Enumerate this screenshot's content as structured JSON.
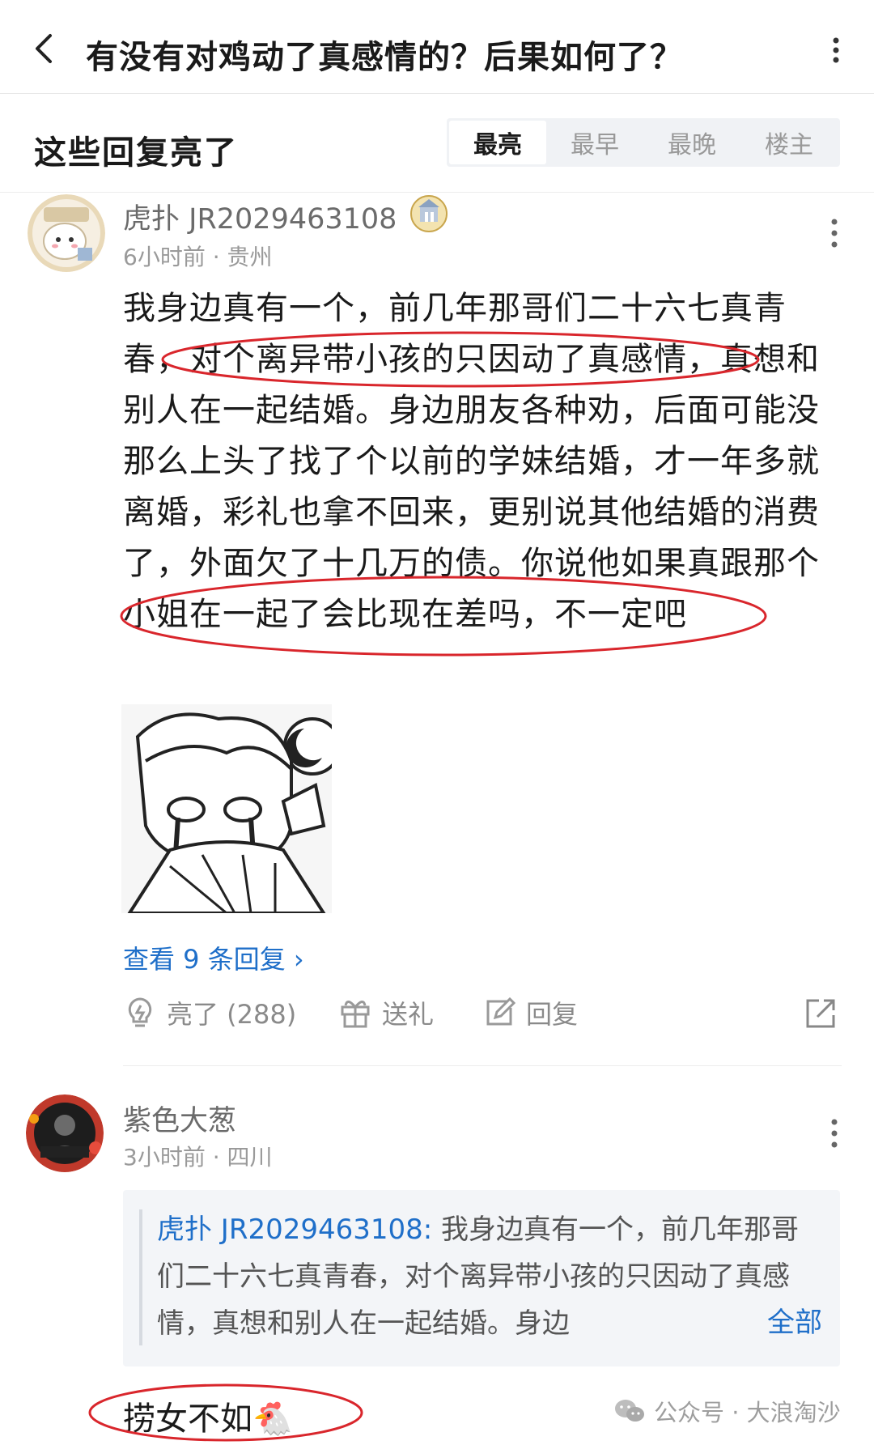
{
  "header": {
    "title": "有没有对鸡动了真感情的？后果如何了？"
  },
  "section": {
    "title": "这些回复亮了",
    "sort_tabs": [
      {
        "label": "最亮",
        "active": true
      },
      {
        "label": "最早",
        "active": false
      },
      {
        "label": "最晚",
        "active": false
      },
      {
        "label": "楼主",
        "active": false
      }
    ]
  },
  "comment1": {
    "username": "虎扑 JR2029463108",
    "time": "6小时前",
    "location": "贵州",
    "text": "我身边真有一个，前几年那哥们二十六七真青春，对个离异带小孩的只因动了真感情，真想和别人在一起结婚。身边朋友各种劝，后面可能没那么上头了找了个以前的学妹结婚，才一年多就离婚，彩礼也拿不回来，更别说其他结婚的消费了，外面欠了十几万的债。你说他如果真跟那个小姐在一起了会比现在差吗，不一定吧",
    "view_replies": "查看 9 条回复",
    "actions": {
      "light_label": "亮了 (288)",
      "gift_label": "送礼",
      "reply_label": "回复"
    }
  },
  "comment2": {
    "username": "紫色大葱",
    "time": "3小时前",
    "location": "四川",
    "quote_author": "虎扑 JR2029463108:",
    "quote_text": "我身边真有一个，前几年那哥们二十六七真青春，对个离异带小孩的只因动了真感情，真想和别人在一起结婚。身边",
    "quote_full_label": "全部",
    "text": "捞女不如🐔"
  },
  "watermark": {
    "text": "公众号 · 大浪淘沙"
  },
  "colors": {
    "link_blue": "#1f6fc9",
    "annotation_red": "#d9262c"
  }
}
